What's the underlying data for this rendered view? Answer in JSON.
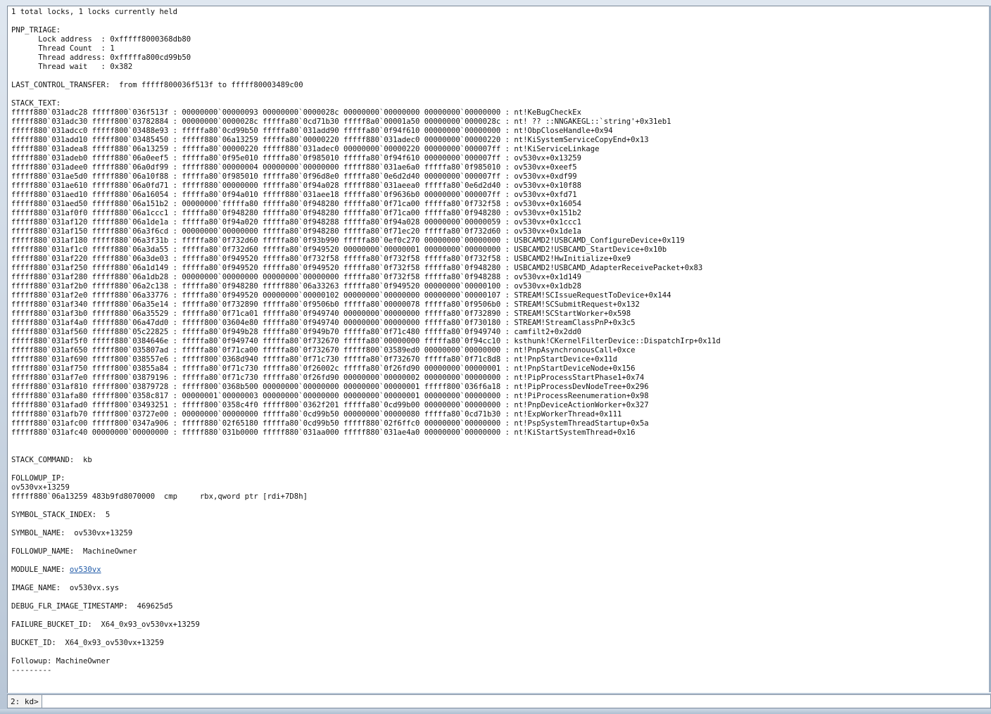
{
  "output": {
    "lines_top": [
      "1 total locks, 1 locks currently held",
      "",
      "PNP_TRIAGE:",
      "      Lock address  : 0xfffff8000368db80",
      "      Thread Count  : 1",
      "      Thread address: 0xfffffa800cd99b50",
      "      Thread wait   : 0x382",
      "",
      "LAST_CONTROL_TRANSFER:  from fffff800036f513f to fffff80003489c00",
      "",
      "STACK_TEXT:",
      "fffff880`031adc28 fffff800`036f513f : 00000000`00000093 00000000`0000028c 00000000`00000000 00000000`00000000 : nt!KeBugCheckEx",
      "fffff880`031adc30 fffff800`03782884 : 00000000`0000028c fffffa80`0cd71b30 fffff8a0`00001a50 00000000`0000028c : nt! ?? ::NNGAKEGL::`string'+0x31eb1",
      "fffff880`031adcc0 fffff800`03488e93 : fffffa80`0cd99b50 fffffa80`031add90 fffffa80`0f94f610 00000000`00000000 : nt!ObpCloseHandle+0x94",
      "fffff880`031add10 fffff800`03485450 : fffff880`06a13259 fffffa80`00000220 fffff880`031adec0 00000000`00000220 : nt!KiSystemServiceCopyEnd+0x13",
      "fffff880`031adea8 fffff880`06a13259 : fffffa80`00000220 fffff880`031adec0 00000000`00000220 00000000`000007ff : nt!KiServiceLinkage",
      "fffff880`031adeb0 fffff880`06a0eef5 : fffffa80`0f95e010 fffffa80`0f985010 fffffa80`0f94f610 00000000`000007ff : ov530vx+0x13259",
      "fffff880`031adee0 fffff880`06a0df99 : fffff880`00000004 00000000`00000000 fffff880`031ae6a0 fffffa80`0f985010 : ov530vx+0xeef5",
      "fffff880`031ae5d0 fffff880`06a10f88 : fffffa80`0f985010 fffffa80`0f96d8e0 fffffa80`0e6d2d40 00000000`000007ff : ov530vx+0xdf99",
      "fffff880`031ae610 fffff880`06a0fd71 : fffff880`00000000 fffffa80`0f94a028 fffff880`031aeea0 fffffa80`0e6d2d40 : ov530vx+0x10f88",
      "fffff880`031aed10 fffff880`06a16054 : fffffa80`0f94a010 fffff880`031aee18 fffffa80`0f9636b0 00000000`000007ff : ov530vx+0xfd71",
      "fffff880`031aed50 fffff880`06a151b2 : 00000000`fffffa80 fffffa80`0f948280 fffffa80`0f71ca00 fffffa80`0f732f58 : ov530vx+0x16054",
      "fffff880`031af0f0 fffff880`06a1ccc1 : fffffa80`0f948280 fffffa80`0f948280 fffffa80`0f71ca00 fffffa80`0f948280 : ov530vx+0x151b2",
      "fffff880`031af120 fffff880`06a1de1a : fffffa80`0f94a020 fffffa80`0f948288 fffffa80`0f94a028 00000000`00000059 : ov530vx+0x1ccc1",
      "fffff880`031af150 fffff880`06a3f6cd : 00000000`00000000 fffffa80`0f948280 fffffa80`0f71ec20 fffffa80`0f732d60 : ov530vx+0x1de1a",
      "fffff880`031af180 fffff880`06a3f31b : fffffa80`0f732d60 fffffa80`0f93b990 fffffa80`0ef0c270 00000000`00000000 : USBCAMD2!USBCAMD_ConfigureDevice+0x119",
      "fffff880`031af1c0 fffff880`06a3da55 : fffffa80`0f732d60 fffffa80`0f949520 00000000`00000001 00000000`00000000 : USBCAMD2!USBCAMD_StartDevice+0x10b",
      "fffff880`031af220 fffff880`06a3de03 : fffffa80`0f949520 fffffa80`0f732f58 fffffa80`0f732f58 fffffa80`0f732f58 : USBCAMD2!HwInitialize+0xe9",
      "fffff880`031af250 fffff880`06a1d149 : fffffa80`0f949520 fffffa80`0f949520 fffffa80`0f732f58 fffffa80`0f948280 : USBCAMD2!USBCAMD_AdapterReceivePacket+0x83",
      "fffff880`031af280 fffff880`06a1db28 : 00000000`00000000 00000000`00000000 fffffa80`0f732f58 fffffa80`0f948288 : ov530vx+0x1d149",
      "fffff880`031af2b0 fffff880`06a2c138 : fffffa80`0f948280 fffff880`06a33263 fffffa80`0f949520 00000000`00000100 : ov530vx+0x1db28",
      "fffff880`031af2e0 fffff880`06a33776 : fffffa80`0f949520 00000000`00000102 00000000`00000000 00000000`00000107 : STREAM!SCIssueRequestToDevice+0x144",
      "fffff880`031af340 fffff880`06a35e14 : fffffa80`0f732890 fffffa80`0f9506b0 fffffa80`00000078 fffffa80`0f9506b0 : STREAM!SCSubmitRequest+0x132",
      "fffff880`031af3b0 fffff880`06a35529 : fffffa80`0f71ca01 fffffa80`0f949740 00000000`00000000 fffffa80`0f732890 : STREAM!SCStartWorker+0x598",
      "fffff880`031af4a0 fffff880`06a47dd0 : fffff800`03604e80 fffffa80`0f949740 00000000`00000000 fffffa80`0f730180 : STREAM!StreamClassPnP+0x3c5",
      "fffff880`031af560 fffff880`05c22825 : fffffa80`0f949b28 fffffa80`0f949b70 fffffa80`0f71c480 fffffa80`0f949740 : camfilt2+0x2dd0",
      "fffff880`031af5f0 fffff880`0384646e : fffffa80`0f949740 fffffa80`0f732670 fffffa80`00000000 fffffa80`0f94cc10 : ksthunk!CKernelFilterDevice::DispatchIrp+0x11d",
      "fffff880`031af650 fffff800`035807ad : fffffa80`0f71ca00 fffffa80`0f732670 fffff800`03589ed0 00000000`00000000 : nt!PnpAsynchronousCall+0xce",
      "fffff880`031af690 fffff800`038557e6 : fffff800`0368d940 fffffa80`0f71c730 fffffa80`0f732670 fffffa80`0f71c8d8 : nt!PnpStartDevice+0x11d",
      "fffff880`031af750 fffff800`03855a84 : fffffa80`0f71c730 fffffa80`0f26002c fffffa80`0f26fd90 00000000`00000001 : nt!PnpStartDeviceNode+0x156",
      "fffff880`031af7e0 fffff800`03879196 : fffffa80`0f71c730 fffffa80`0f26fd90 00000000`00000002 00000000`00000000 : nt!PipProcessStartPhase1+0x74",
      "fffff880`031af810 fffff800`03879728 : fffff800`0368b500 00000000`00000000 00000000`00000001 fffff800`036f6a18 : nt!PipProcessDevNodeTree+0x296",
      "fffff880`031afa80 fffff800`0358c817 : 00000001`00000003 00000000`00000000 00000000`00000001 00000000`00000000 : nt!PiProcessReenumeration+0x98",
      "fffff880`031afad0 fffff800`03493251 : fffff800`0358c4f0 fffff800`0362f201 fffffa80`0cd99b00 00000000`00000000 : nt!PnpDeviceActionWorker+0x327",
      "fffff880`031afb70 fffff800`03727e00 : 00000000`00000000 fffffa80`0cd99b50 00000000`00000080 fffffa80`0cd71b30 : nt!ExpWorkerThread+0x111",
      "fffff880`031afc00 fffff800`0347a906 : fffff880`02f65180 fffffa80`0cd99b50 fffff880`02f6ffc0 00000000`00000000 : nt!PspSystemThreadStartup+0x5a",
      "fffff880`031afc40 00000000`00000000 : fffff880`031b0000 fffff880`031aa000 fffff880`031ae4a0 00000000`00000000 : nt!KiStartSystemThread+0x16",
      "",
      "",
      "STACK_COMMAND:  kb",
      "",
      "FOLLOWUP_IP:",
      "ov530vx+13259",
      "fffff880`06a13259 483b9fd8070000  cmp     rbx,qword ptr [rdi+7D8h]",
      "",
      "SYMBOL_STACK_INDEX:  5",
      "",
      "SYMBOL_NAME:  ov530vx+13259",
      "",
      "FOLLOWUP_NAME:  MachineOwner",
      ""
    ],
    "module_name_label": "MODULE_NAME: ",
    "module_name_link": "ov530vx",
    "lines_bottom": [
      "",
      "IMAGE_NAME:  ov530vx.sys",
      "",
      "DEBUG_FLR_IMAGE_TIMESTAMP:  469625d5",
      "",
      "FAILURE_BUCKET_ID:  X64_0x93_ov530vx+13259",
      "",
      "BUCKET_ID:  X64_0x93_ov530vx+13259",
      "",
      "Followup: MachineOwner",
      "---------"
    ]
  },
  "command": {
    "prompt": "2: kd>",
    "value": ""
  }
}
